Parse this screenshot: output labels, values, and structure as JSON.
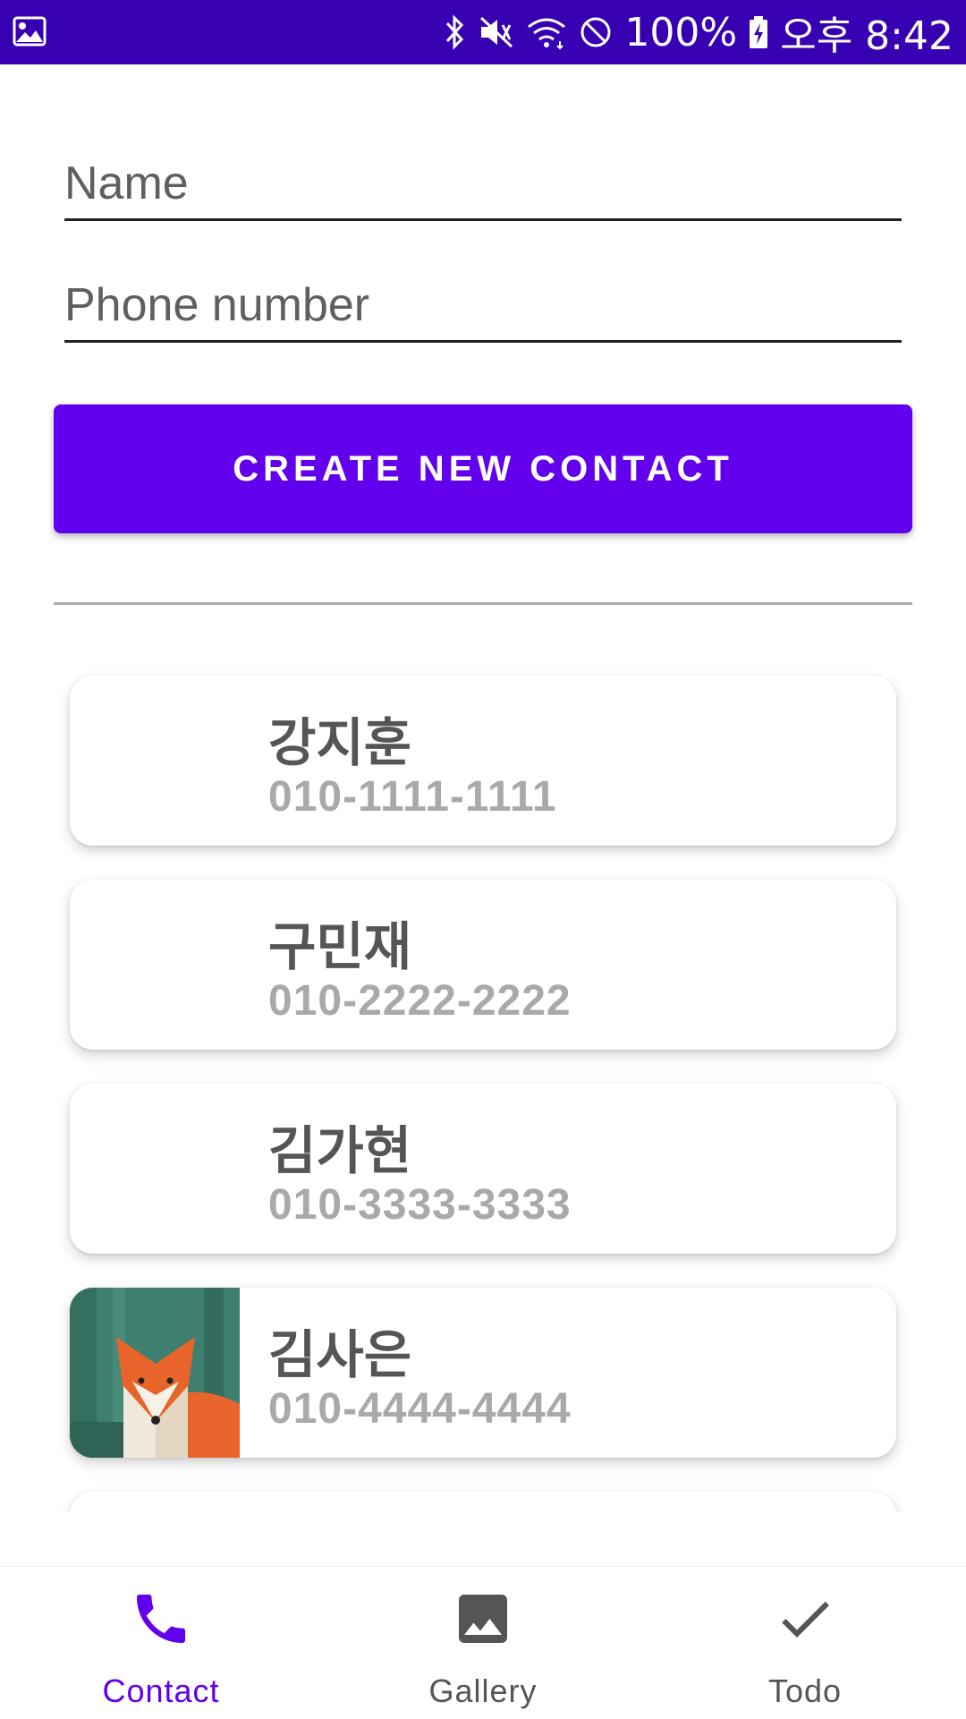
{
  "status_bar": {
    "battery": "100%",
    "time": "오후 8:42",
    "icons": [
      "gallery-notification-icon",
      "bluetooth-icon",
      "vibrate-mute-icon",
      "wifi-icon",
      "do-not-disturb-icon",
      "battery-charging-icon"
    ]
  },
  "form": {
    "name_placeholder": "Name",
    "phone_placeholder": "Phone number",
    "name_value": "",
    "phone_value": "",
    "create_button": "CREATE NEW CONTACT"
  },
  "contacts": [
    {
      "name": "강지훈",
      "phone": "010-1111-1111",
      "avatar": "none"
    },
    {
      "name": "구민재",
      "phone": "010-2222-2222",
      "avatar": "none"
    },
    {
      "name": "김가현",
      "phone": "010-3333-3333",
      "avatar": "none"
    },
    {
      "name": "김사은",
      "phone": "010-4444-4444",
      "avatar": "fox-image"
    }
  ],
  "bottom_nav": {
    "active": "Contact",
    "items": [
      {
        "label": "Contact",
        "icon": "phone-icon"
      },
      {
        "label": "Gallery",
        "icon": "image-icon"
      },
      {
        "label": "Todo",
        "icon": "check-icon"
      }
    ]
  },
  "colors": {
    "status_bar": "#3700b3",
    "primary": "#6200ee",
    "name_text": "#555555",
    "phone_text": "#a9a9a9"
  }
}
